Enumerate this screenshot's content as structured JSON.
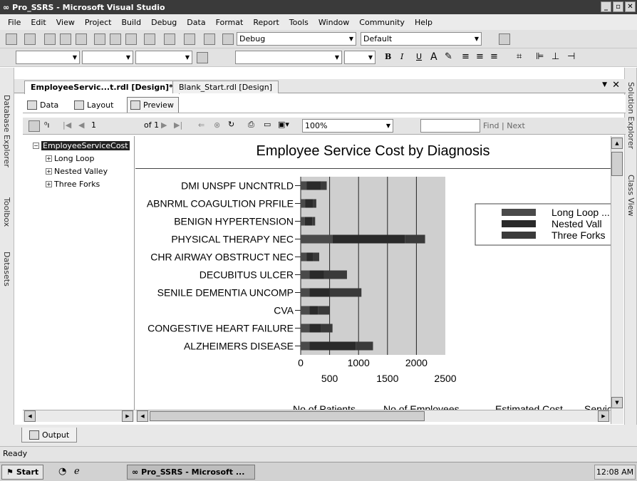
{
  "window": {
    "title": "Pro_SSRS - Microsoft Visual Studio"
  },
  "menu": [
    "File",
    "Edit",
    "View",
    "Project",
    "Build",
    "Debug",
    "Data",
    "Format",
    "Report",
    "Tools",
    "Window",
    "Community",
    "Help"
  ],
  "toolbar": {
    "config": "Debug",
    "platform": "Default"
  },
  "side_tabs": {
    "left": [
      "Database Explorer",
      "Toolbox",
      "Datasets"
    ],
    "right": [
      "Solution Explorer",
      "Class View"
    ]
  },
  "doc_tabs": [
    {
      "label": "EmployeeServic...t.rdl [Design]*"
    },
    {
      "label": "Blank_Start.rdl [Design]"
    }
  ],
  "view_tabs": [
    "Data",
    "Layout",
    "Preview"
  ],
  "preview_toolbar": {
    "page": "1",
    "of_pages": "of 1",
    "zoom": "100%",
    "find_placeholder": "",
    "find_next": "Find | Next"
  },
  "doc_map": {
    "root": "EmployeeServiceCost",
    "children": [
      "Long Loop",
      "Nested Valley",
      "Three Forks"
    ]
  },
  "report_title": "Employee Service Cost by Diagnosis",
  "table_headers": [
    "No of Patients",
    "No of Employees",
    "Estimated Cost",
    "Servic"
  ],
  "chart_data": {
    "type": "bar",
    "orientation": "horizontal",
    "stacked": true,
    "categories": [
      "DMI UNSPF UNCNTRLD",
      "ABNRML COAGULTION PRFILE",
      "BENIGN HYPERTENSION",
      "PHYSICAL THERAPY NEC",
      "CHR AIRWAY OBSTRUCT NEC",
      "DECUBITUS ULCER",
      "SENILE DEMENTIA UNCOMP",
      "CVA",
      "CONGESTIVE HEART FAILURE",
      "ALZHEIMERS DISEASE"
    ],
    "series": [
      {
        "name": "Long Loop ...",
        "color": "#4a4a4a",
        "values": [
          100,
          80,
          70,
          550,
          100,
          150,
          150,
          150,
          150,
          150
        ]
      },
      {
        "name": "Nested Vall",
        "color": "#2a2a2a",
        "values": [
          250,
          130,
          130,
          1250,
          120,
          250,
          350,
          150,
          200,
          800
        ]
      },
      {
        "name": "Three Forks",
        "color": "#3a3a3a",
        "values": [
          100,
          60,
          50,
          350,
          100,
          400,
          550,
          200,
          200,
          300
        ]
      }
    ],
    "xlim": [
      0,
      2500
    ],
    "xticks_top": [
      "0",
      "1000",
      "2000"
    ],
    "xticks_bottom": [
      "500",
      "1500",
      "2500"
    ],
    "grid": true,
    "legend": "right"
  },
  "status": {
    "text": "Ready"
  },
  "output_tab": "Output",
  "taskbar": {
    "start": "Start",
    "task": "Pro_SSRS - Microsoft ...",
    "clock": "12:08 AM"
  }
}
